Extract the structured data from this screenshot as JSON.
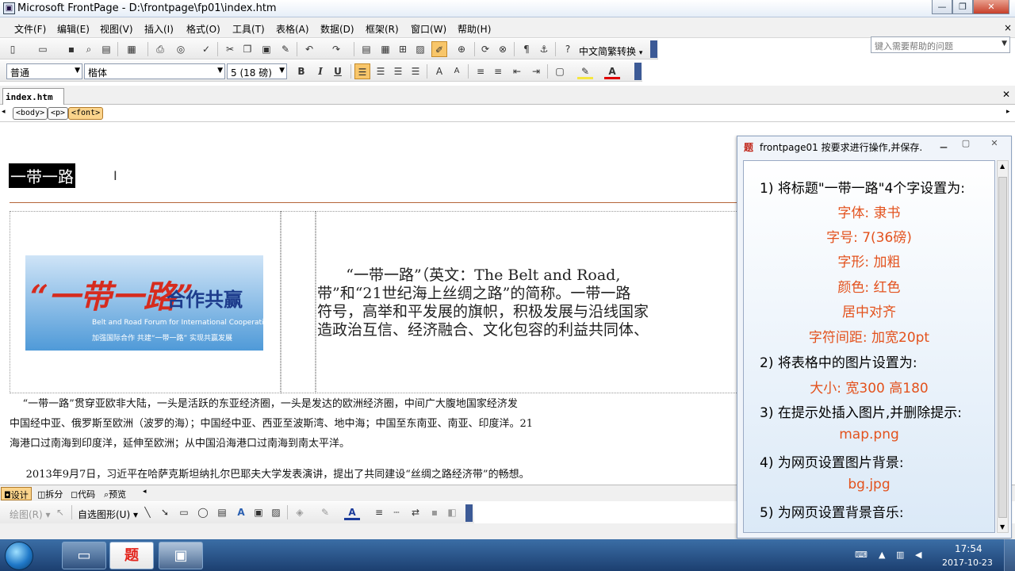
{
  "window": {
    "title": "Microsoft FrontPage - D:\\frontpage\\fp01\\index.htm",
    "min_glyph": "—",
    "restore_glyph": "❐",
    "close_glyph": "✕"
  },
  "menu": [
    "文件(F)",
    "编辑(E)",
    "视图(V)",
    "插入(I)",
    "格式(O)",
    "工具(T)",
    "表格(A)",
    "数据(D)",
    "框架(R)",
    "窗口(W)",
    "帮助(H)"
  ],
  "help": {
    "placeholder": "键入需要帮助的问题"
  },
  "toolbar1": {
    "convert_label": "中文简繁转换"
  },
  "format": {
    "style": "普通",
    "font": "楷体",
    "size": "5 (18 磅)",
    "bold": "B",
    "italic": "I",
    "underline": "U"
  },
  "tabs": {
    "doc": "index.htm"
  },
  "tagbar": [
    "<body>",
    "<p>",
    "<font>"
  ],
  "doc": {
    "heading": "一带一路",
    "banner": {
      "main": "“一带一路”",
      "side": "合作共赢",
      "en": "Belt and Road Forum for International Cooperation",
      "sub": "加强国际合作  共建“一带一路”  实现共赢发展"
    },
    "big_lines": [
      "      “一带一路”（英文：The Belt and Road,",
      "带”和“21世纪海上丝绸之路”的简称。一带一路",
      "符号，高举和平发展的旗帜，积极发展与沿线国家",
      "造政治互信、经济融合、文化包容的利益共同体、"
    ],
    "para1": [
      "    “一带一路”贯穿亚欧非大陆，一头是活跃的东亚经济圈，一头是发达的欧洲经济圈，中间广大腹地国家经济发",
      "中国经中亚、俄罗斯至欧洲（波罗的海）；中国经中亚、西亚至波斯湾、地中海；中国至东南亚、南亚、印度洋。21",
      "海港口过南海到印度洋，延伸至欧洲；从中国沿海港口过南海到南太平洋。"
    ],
    "para2": "     2013年9月7日，习近平在哈萨克斯坦纳扎尔巴耶夫大学发表演讲，提出了共同建设“丝绸之路经济带”的畅想。"
  },
  "viewtabs": [
    "设计",
    "拆分",
    "代码",
    "预览"
  ],
  "drawing": {
    "draw_label": "绘图(R)",
    "autoshape_label": "自选图形(U)"
  },
  "panel": {
    "title": "frontpage01 按要求进行操作,并保存.",
    "icon": "题",
    "lines": [
      {
        "t": "1) 将标题\"一带一路\"4个字设置为:",
        "o": false
      },
      {
        "t": "字体: 隶书",
        "o": true
      },
      {
        "t": "字号: 7(36磅)",
        "o": true
      },
      {
        "t": "字形: 加粗",
        "o": true
      },
      {
        "t": "颜色: 红色",
        "o": true
      },
      {
        "t": "居中对齐",
        "o": true
      },
      {
        "t": "字符间距: 加宽20pt",
        "o": true
      },
      {
        "t": "2) 将表格中的图片设置为:",
        "o": false
      },
      {
        "t": "大小: 宽300     高180",
        "o": true
      },
      {
        "t": "3) 在提示处插入图片,并删除提示:",
        "o": false
      },
      {
        "t": "map.png",
        "o": true
      },
      {
        "t": "4) 为网页设置图片背景:",
        "o": false
      },
      {
        "t": "bg.jpg",
        "o": true
      },
      {
        "t": "5) 为网页设置背景音乐:",
        "o": false
      }
    ]
  },
  "taskbar": {
    "time": "17:54",
    "date": "2017-10-23",
    "item_ti": "题"
  },
  "colors": {
    "accent_orange": "#e3521d",
    "hr": "#b5653a",
    "taskbar": "#1c3f70"
  }
}
